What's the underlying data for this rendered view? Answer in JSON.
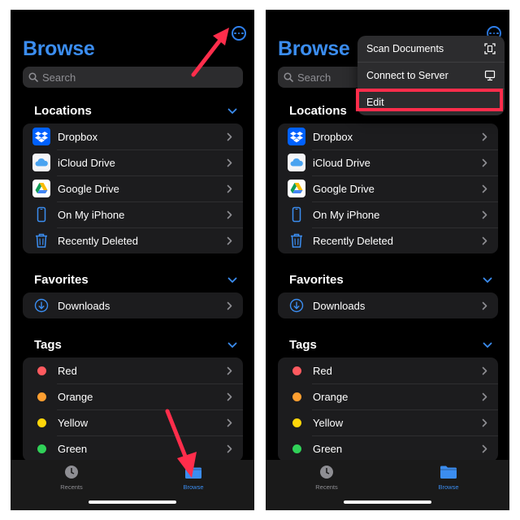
{
  "colors": {
    "accent": "#3b8df0",
    "annotation": "#ff2d4b",
    "tag_red": "#ff5a5f",
    "tag_orange": "#ff9f30",
    "tag_yellow": "#ffd60a",
    "tag_green": "#30d158",
    "dropbox_blue": "#0061ff"
  },
  "screens": [
    {
      "title": "Browse",
      "search_placeholder": "Search",
      "locations": {
        "heading": "Locations",
        "items": [
          {
            "label": "Dropbox",
            "icon": "dropbox-icon"
          },
          {
            "label": "iCloud Drive",
            "icon": "icloud-icon"
          },
          {
            "label": "Google Drive",
            "icon": "google-drive-icon"
          },
          {
            "label": "On My iPhone",
            "icon": "iphone-icon"
          },
          {
            "label": "Recently Deleted",
            "icon": "trash-icon"
          }
        ]
      },
      "favorites": {
        "heading": "Favorites",
        "items": [
          {
            "label": "Downloads",
            "icon": "downloads-icon"
          }
        ]
      },
      "tags": {
        "heading": "Tags",
        "items": [
          {
            "label": "Red",
            "icon": "red-tag-dot"
          },
          {
            "label": "Orange",
            "icon": "orange-tag-dot"
          },
          {
            "label": "Yellow",
            "icon": "yellow-tag-dot"
          },
          {
            "label": "Green",
            "icon": "green-tag-dot"
          }
        ]
      },
      "tabbar": {
        "recents": "Recents",
        "browse": "Browse",
        "active": "browse"
      }
    },
    {
      "title": "Browse",
      "search_placeholder": "Search",
      "locations": {
        "heading": "Locations",
        "items": [
          {
            "label": "Dropbox",
            "icon": "dropbox-icon"
          },
          {
            "label": "iCloud Drive",
            "icon": "icloud-icon"
          },
          {
            "label": "Google Drive",
            "icon": "google-drive-icon"
          },
          {
            "label": "On My iPhone",
            "icon": "iphone-icon"
          },
          {
            "label": "Recently Deleted",
            "icon": "trash-icon"
          }
        ]
      },
      "favorites": {
        "heading": "Favorites",
        "items": [
          {
            "label": "Downloads",
            "icon": "downloads-icon"
          }
        ]
      },
      "tags": {
        "heading": "Tags",
        "items": [
          {
            "label": "Red",
            "icon": "red-tag-dot"
          },
          {
            "label": "Orange",
            "icon": "orange-tag-dot"
          },
          {
            "label": "Yellow",
            "icon": "yellow-tag-dot"
          },
          {
            "label": "Green",
            "icon": "green-tag-dot"
          }
        ]
      },
      "tabbar": {
        "recents": "Recents",
        "browse": "Browse",
        "active": "browse"
      },
      "menu": {
        "items": [
          {
            "label": "Scan Documents",
            "icon": "scan-document-icon"
          },
          {
            "label": "Connect to Server",
            "icon": "monitor-icon"
          },
          {
            "label": "Edit",
            "icon": ""
          }
        ]
      }
    }
  ]
}
